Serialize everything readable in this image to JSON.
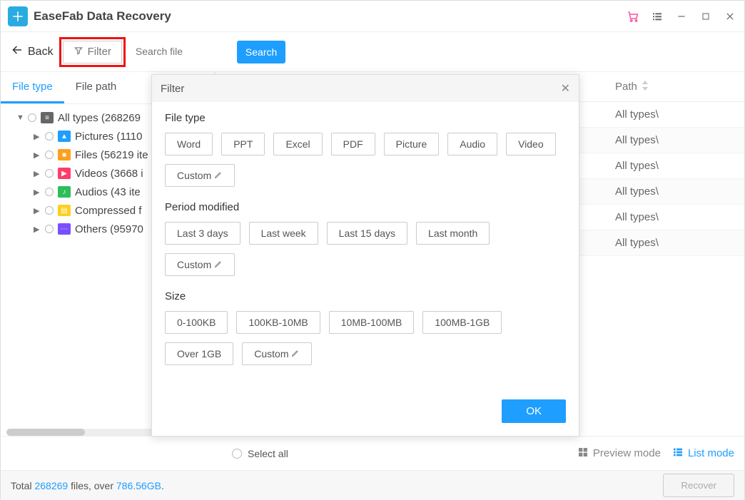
{
  "app": {
    "title": "EaseFab Data Recovery"
  },
  "toolbar": {
    "back_label": "Back",
    "filter_label": "Filter",
    "search_placeholder": "Search file",
    "search_button": "Search"
  },
  "sidebar": {
    "tabs": {
      "file_type": "File type",
      "file_path": "File path"
    },
    "tree": [
      {
        "label": "All types (268269",
        "icon_color": "#666",
        "expanded": true
      },
      {
        "label": "Pictures (1110",
        "icon_color": "#1e9eff"
      },
      {
        "label": "Files (56219 ite",
        "icon_color": "#ff9f1e"
      },
      {
        "label": "Videos (3668 i",
        "icon_color": "#ff3d6a"
      },
      {
        "label": "Audios (43 ite",
        "icon_color": "#2dbd5a"
      },
      {
        "label": "Compressed f",
        "icon_color": "#ffcf1e"
      },
      {
        "label": "Others (95970",
        "icon_color": "#7b4fff"
      }
    ]
  },
  "content": {
    "columns": {
      "path": "Path"
    },
    "rows": [
      "All types\\",
      "All types\\",
      "All types\\",
      "All types\\",
      "All types\\",
      "All types\\"
    ]
  },
  "dialog": {
    "title": "Filter",
    "sections": {
      "file_type": {
        "title": "File type",
        "chips": [
          "Word",
          "PPT",
          "Excel",
          "PDF",
          "Picture",
          "Audio",
          "Video"
        ],
        "custom": "Custom"
      },
      "period": {
        "title": "Period modified",
        "chips": [
          "Last 3 days",
          "Last week",
          "Last 15 days",
          "Last month"
        ],
        "custom": "Custom"
      },
      "size": {
        "title": "Size",
        "chips": [
          "0-100KB",
          "100KB-10MB",
          "10MB-100MB",
          "100MB-1GB",
          "Over 1GB"
        ],
        "custom": "Custom"
      }
    },
    "ok_label": "OK"
  },
  "bottombar": {
    "select_all": "Select all",
    "preview_mode": "Preview mode",
    "list_mode": "List mode"
  },
  "footer": {
    "prefix": "Total ",
    "file_count": "268269",
    "mid": " files, over ",
    "size": "786.56GB",
    "suffix": ".",
    "recover_label": "Recover"
  }
}
